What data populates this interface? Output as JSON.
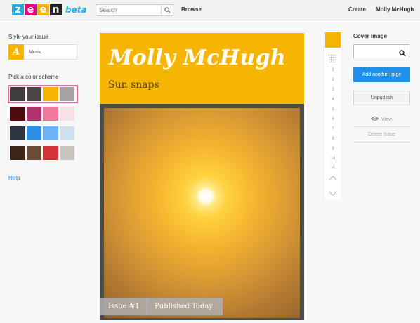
{
  "header": {
    "logo_letters": [
      {
        "char": "z",
        "color": "#2aa7e0"
      },
      {
        "char": "e",
        "color": "#e6007e"
      },
      {
        "char": "e",
        "color": "#f4b400"
      },
      {
        "char": "n",
        "color": "#222222"
      }
    ],
    "logo_suffix": "beta",
    "search_placeholder": "Search",
    "browse_label": "Browse",
    "create_label": "Create",
    "user_name": "Molly McHugh"
  },
  "style_panel": {
    "title": "Style your issue",
    "theme_icon_letter": "A",
    "theme_name": "Music",
    "color_scheme_title": "Pick a color scheme",
    "schemes": [
      {
        "selected": true,
        "colors": [
          "#3d3b3e",
          "#4c4546",
          "#f4b400",
          "#a3a3a3"
        ]
      },
      {
        "selected": false,
        "colors": [
          "#4d0a10",
          "#b2336b",
          "#f1799e",
          "#f6e0e6"
        ]
      },
      {
        "selected": false,
        "colors": [
          "#2c3442",
          "#2f8fe4",
          "#6cb4f6",
          "#cfe0f0"
        ]
      },
      {
        "selected": false,
        "colors": [
          "#3b2618",
          "#6b4b36",
          "#d33236",
          "#c9c3bd"
        ]
      }
    ],
    "help_label": "Help"
  },
  "cover": {
    "title": "Molly McHugh",
    "subtitle": "Sun snaps",
    "issue_label": "Issue #1",
    "status_label": "Published Today",
    "accent_color": "#f4b400"
  },
  "page_strip": {
    "page_numbers": [
      "1",
      "2",
      "3",
      "4",
      "5",
      "6",
      "7",
      "8",
      "9",
      "10",
      "11"
    ]
  },
  "actions": {
    "cover_image_title": "Cover image",
    "add_page_label": "Add another page",
    "unpublish_label": "Unpublish",
    "view_label": "View",
    "delete_label": "Delete Issue"
  }
}
